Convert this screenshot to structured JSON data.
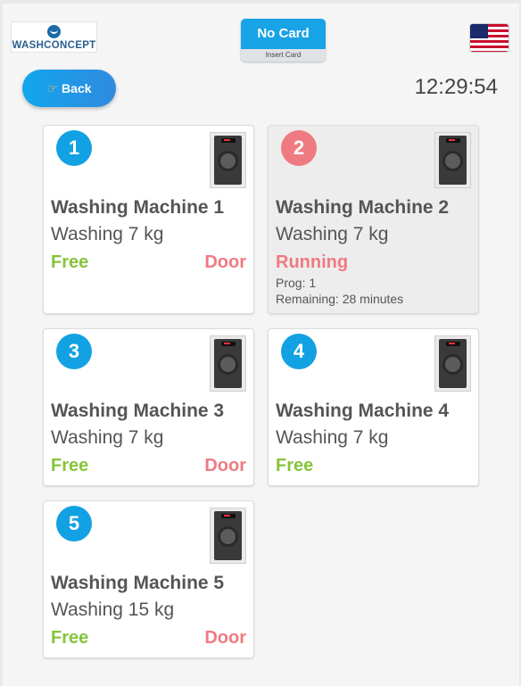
{
  "header": {
    "logo_text": "WASHCONCEPT",
    "card_button": {
      "label": "No Card",
      "sub_label": "Insert Card"
    },
    "language_flag": "us-flag",
    "back_button": {
      "label": "Back",
      "icon": "pointing-hand-icon"
    },
    "clock": "12:29:54"
  },
  "colors": {
    "accent_blue": "#12a1e3",
    "free_green": "#86c43b",
    "alert_red": "#f07a82"
  },
  "machines": [
    {
      "number": "1",
      "title": "Washing Machine 1",
      "capacity": "Washing 7 kg",
      "status": "Free",
      "door": "Door"
    },
    {
      "number": "2",
      "title": "Washing Machine 2",
      "capacity": "Washing 7 kg",
      "status": "Running",
      "program": "Prog: 1",
      "remaining": "Remaining: 28 minutes"
    },
    {
      "number": "3",
      "title": "Washing Machine 3",
      "capacity": "Washing 7 kg",
      "status": "Free",
      "door": "Door"
    },
    {
      "number": "4",
      "title": "Washing Machine 4",
      "capacity": "Washing 7 kg",
      "status": "Free"
    },
    {
      "number": "5",
      "title": "Washing Machine 5",
      "capacity": "Washing 15 kg",
      "status": "Free",
      "door": "Door"
    }
  ]
}
